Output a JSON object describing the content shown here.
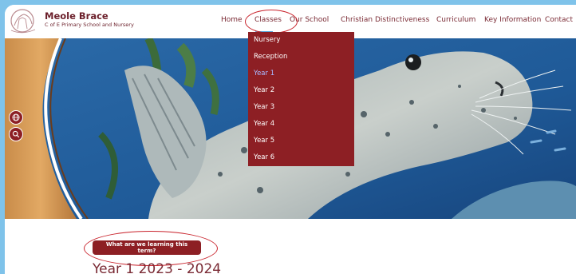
{
  "brand": {
    "name": "Meole Brace",
    "subtitle": "C of E Primary School and Nursery"
  },
  "nav": {
    "items": [
      {
        "label": "Home"
      },
      {
        "label": "Classes"
      },
      {
        "label": "Our School"
      },
      {
        "label": "Christian Distinctiveness"
      },
      {
        "label": "Curriculum"
      },
      {
        "label": "Key Information"
      },
      {
        "label": "Contact"
      }
    ]
  },
  "dropdown": {
    "items": [
      {
        "label": "Nursery"
      },
      {
        "label": "Reception"
      },
      {
        "label": "Year 1"
      },
      {
        "label": "Year 2"
      },
      {
        "label": "Year 3"
      },
      {
        "label": "Year 4"
      },
      {
        "label": "Year 5"
      },
      {
        "label": "Year 6"
      }
    ],
    "active": "Year 1"
  },
  "content": {
    "cta_label": "What are we learning this term?",
    "heading": "Year 1 2023 - 2024"
  },
  "colors": {
    "brand": "#8d1f24",
    "accent": "#5aa9de",
    "annotation": "#c9242d",
    "background": "#7fc3ea"
  },
  "icons": {
    "side": [
      "globe-icon",
      "search-icon"
    ]
  }
}
